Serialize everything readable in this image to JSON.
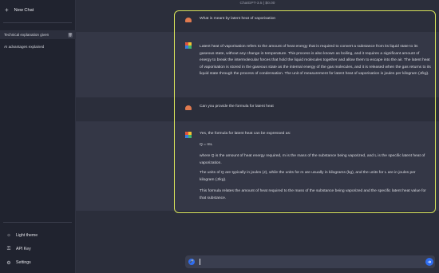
{
  "sidebar": {
    "new_chat": "New Chat",
    "conversations": [
      {
        "label": "Technical explanation given"
      },
      {
        "label": "AI advantages explained"
      }
    ],
    "bottom": {
      "light_theme": "Light theme",
      "api_key": "API Key",
      "settings": "Settings"
    }
  },
  "header": {
    "title": "ChatGPT-3.5 | $0.00"
  },
  "messages": {
    "q1": "What is meant by latent heat of vaporisation",
    "a1": "Latent heat of vaporisation refers to the amount of heat energy that is required to convert a substance from its liquid state to its gaseous state, without any change in temperature. This process is also known as boiling, and it requires a significant amount of energy to break the intermolecular forces that hold the liquid molecules together and allow them to escape into the air. The latent heat of vaporisation is stored in the gaseous state as the internal energy of the gas molecules, and it is released when the gas returns to its liquid state through the process of condensation. The unit of measurement for latent heat of vaporisation is joules per kilogram (J/kg).",
    "q2": "Can you provide the formula for latent heat",
    "a2_p1": "Yes, the formula for latent heat can be expressed as:",
    "a2_p2": "Q = mL",
    "a2_p3": "where Q is the amount of heat energy required, m is the mass of the substance being vaporized, and L is the specific latent heat of vaporization.",
    "a2_p4": "The units of Q are typically in joules (J), while the units for m are usually in kilograms (kg), and the units for L are in joules per kilogram (J/kg).",
    "a2_p5": "This formula relates the amount of heat required to the mass of the substance being vaporized and the specific latent heat value for that substance."
  },
  "input": {
    "value": ""
  },
  "colors": {
    "highlight": "#d8e35a",
    "accent": "#2f6df0",
    "user_avatar": "#e07a4f"
  },
  "icons": {
    "new_chat": "plus-icon",
    "delete": "trash-icon",
    "light_theme": "sun-icon",
    "api_key": "key-icon",
    "settings": "gear-icon",
    "mic": "microphone-icon",
    "send": "arrow-right-icon"
  }
}
